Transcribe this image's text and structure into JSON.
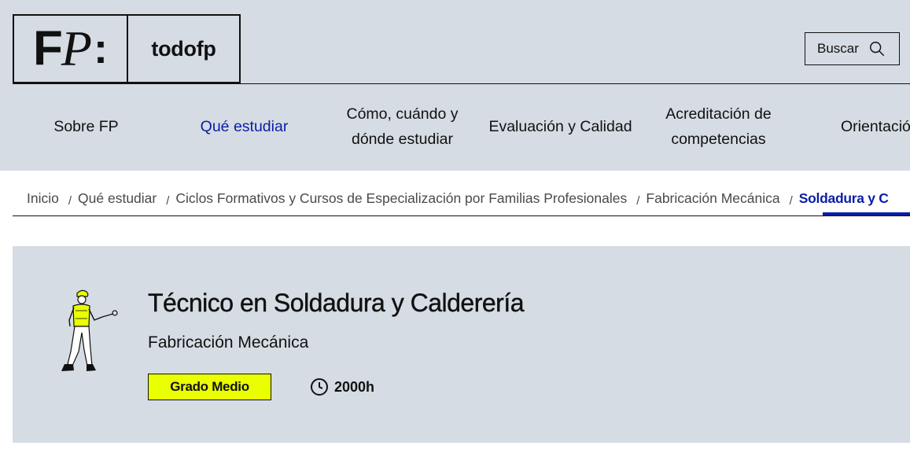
{
  "header": {
    "logo_mark": {
      "f": "F",
      "p": "P",
      "colon": ":"
    },
    "logo_text": "todofp",
    "search_label": "Buscar",
    "search_icon": "search-icon"
  },
  "nav": {
    "items": [
      {
        "label": "Sobre FP"
      },
      {
        "label": "Qué estudiar",
        "active": true
      },
      {
        "label": "Cómo, cuándo y dónde estudiar"
      },
      {
        "label": "Evaluación y Calidad"
      },
      {
        "label": "Acreditación de competencias"
      },
      {
        "label": "Orientació"
      }
    ]
  },
  "breadcrumb": {
    "items": [
      "Inicio",
      "Qué estudiar",
      "Ciclos Formativos y Cursos de Especialización por Familias Profesionales",
      "Fabricación Mecánica",
      "Soldadura y C"
    ],
    "separator": "/"
  },
  "hero": {
    "title": "Técnico en Soldadura y Calderería",
    "family": "Fabricación Mecánica",
    "level": "Grado Medio",
    "duration": "2000h",
    "duration_icon": "clock-icon",
    "illustration": "welder-illustration"
  },
  "colors": {
    "header_bg": "#d5dce3",
    "accent": "#0b1ea6",
    "badge": "#eaff00"
  }
}
